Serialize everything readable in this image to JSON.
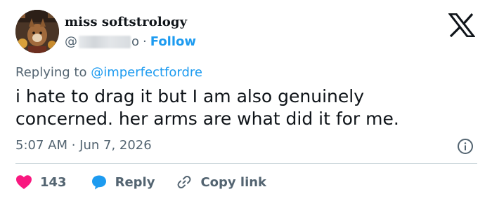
{
  "author": {
    "display_name": "miss softstrology",
    "handle_prefix": "@",
    "handle_suffix": "o",
    "separator": "·",
    "follow_label": "Follow"
  },
  "reply_context": {
    "prefix": "Replying to ",
    "mention": "@imperfectfordre"
  },
  "tweet": {
    "lines": [
      "i hate to drag it but I am also genuinely",
      "concerned. her arms are what did it for me."
    ],
    "timestamp": "5:07 AM · Jun 7, 2026"
  },
  "actions": {
    "like_count": "143",
    "reply_label": "Reply",
    "copy_link_label": "Copy link"
  },
  "icons": {
    "platform_logo": "x-logo-icon",
    "info": "info-icon",
    "like": "heart-icon",
    "reply": "speech-bubble-icon",
    "copy": "link-icon"
  },
  "colors": {
    "accent": "#1d9bf0",
    "like": "#f91880",
    "text_primary": "#0f1419",
    "text_secondary": "#536471",
    "divider": "#cfd9de"
  }
}
